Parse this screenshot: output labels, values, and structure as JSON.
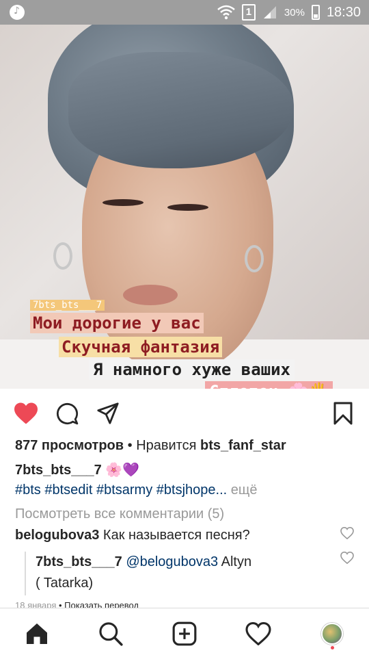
{
  "status_bar": {
    "battery_pct": "30%",
    "time": "18:30",
    "sim": "1"
  },
  "overlay": {
    "username": "7bts_bts___7",
    "line1": "Мои дорогие у вас",
    "line2": "Скучная фантазия",
    "line3": "Я намного хуже ваших",
    "line4": "Сплетен.🌸🖐"
  },
  "post": {
    "views": "877 просмотров",
    "liked_by_prefix": " • Нравится ",
    "liked_by_user": "bts_fanf_star",
    "author": "7bts_bts___7",
    "caption_emoji": " 🌸💜",
    "hashtags": "#bts #btsedit #btsarmy #btsjhope",
    "more_ellipsis": "...",
    "more_label": "ещё",
    "view_comments": "Посмотреть все комментарии (5)",
    "comment1_user": "belogubova3",
    "comment1_text": " Как называется песня?",
    "reply_user": "7bts_bts___7",
    "reply_mention": "@belogubova3",
    "reply_text_line1": " Altyn",
    "reply_text_line2": "( Tatarka)",
    "date": "18 января",
    "translate_label": " • Показать перевод"
  },
  "colors": {
    "like_red": "#ed4956",
    "link_blue": "#003569",
    "muted": "#999999"
  },
  "icons": {
    "like": "heart-filled-icon",
    "comment": "comment-icon",
    "share": "paper-plane-icon",
    "save": "bookmark-icon",
    "home": "home-icon",
    "search": "search-icon",
    "add": "plus-square-icon",
    "activity": "heart-outline-icon",
    "profile": "avatar"
  }
}
